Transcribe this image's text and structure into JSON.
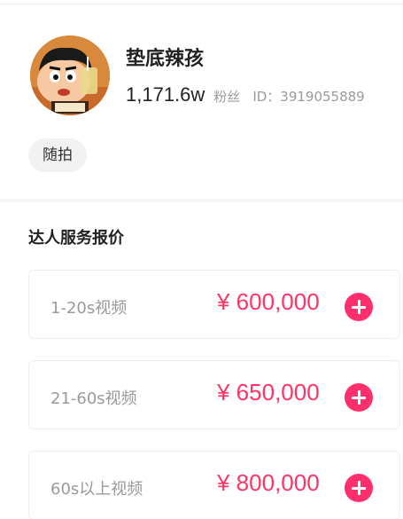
{
  "profile": {
    "name": "垫底辣孩",
    "followers": "1,171.6w",
    "followers_label": "粉丝",
    "user_id": "ID：3919055889",
    "avatar_icon": "cartoon-boy-avatar"
  },
  "tags": [
    "随拍"
  ],
  "section": {
    "title": "达人服务报价"
  },
  "pricing": [
    {
      "label": "1-20s视频",
      "price": "¥ 600,000"
    },
    {
      "label": "21-60s视频",
      "price": "¥ 650,000"
    },
    {
      "label": "60s以上视频",
      "price": "¥ 800,000"
    }
  ],
  "colors": {
    "price": "#ff3366",
    "add_button": "#ff2f6d",
    "muted_text": "#9a9a9a",
    "tag_bg": "#f2f2f2"
  }
}
